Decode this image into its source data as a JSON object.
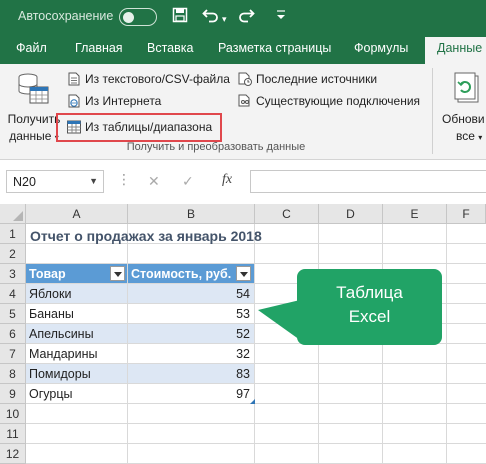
{
  "titlebar": {
    "autosave_label": "Автосохранение",
    "icons": [
      "save-icon",
      "undo-icon",
      "redo-icon",
      "customize-dropdown-icon"
    ]
  },
  "tabs": [
    {
      "label": "Файл"
    },
    {
      "label": "Главная"
    },
    {
      "label": "Вставка"
    },
    {
      "label": "Разметка страницы"
    },
    {
      "label": "Формулы"
    },
    {
      "label": "Данные"
    }
  ],
  "ribbon": {
    "get_data_label": "Получить данные",
    "get_data_line1": "Получить",
    "get_data_line2": "данные",
    "from_text_csv": "Из текстового/CSV-файла",
    "from_web": "Из Интернета",
    "from_table_range": "Из таблицы/диапазона",
    "recent_sources": "Последние источники",
    "existing_connections": "Существующие подключения",
    "group_label": "Получить и преобразовать данные",
    "refresh_line1": "Обнови",
    "refresh_line2": "все"
  },
  "formula_bar": {
    "name_box": "N20",
    "fx_label": "fx",
    "formula": ""
  },
  "grid": {
    "columns": [
      "A",
      "B",
      "C",
      "D",
      "E",
      "F"
    ],
    "rows": [
      "1",
      "2",
      "3",
      "4",
      "5",
      "6",
      "7",
      "8",
      "9",
      "10",
      "11",
      "12"
    ],
    "title": "Отчет о продажах за январь 2018",
    "table_headers": [
      "Товар",
      "Стоимость, руб."
    ],
    "table_rows": [
      {
        "item": "Яблоки",
        "value": "54"
      },
      {
        "item": "Бананы",
        "value": "53"
      },
      {
        "item": "Апельсины",
        "value": "52"
      },
      {
        "item": "Мандарины",
        "value": "32"
      },
      {
        "item": "Помидоры",
        "value": "83"
      },
      {
        "item": "Огурцы",
        "value": "97"
      }
    ]
  },
  "callout": {
    "line1": "Таблица",
    "line2": "Excel"
  },
  "colors": {
    "brand": "#217346",
    "table_header": "#5b9bd5",
    "table_band": "#dde7f4",
    "callout": "#21a366",
    "highlight": "#e0474c"
  }
}
